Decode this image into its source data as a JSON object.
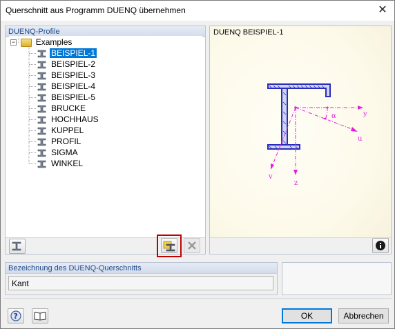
{
  "window": {
    "title": "Querschnitt aus Programm DUENQ übernehmen",
    "close_glyph": "✕"
  },
  "left_group": {
    "header": "DUENQ-Profile"
  },
  "tree": {
    "root": "Examples",
    "items": [
      {
        "label": "BEISPIEL-1",
        "selected": true
      },
      {
        "label": "BEISPIEL-2"
      },
      {
        "label": "BEISPIEL-3"
      },
      {
        "label": "BEISPIEL-4"
      },
      {
        "label": "BEISPIEL-5"
      },
      {
        "label": "BRUCKE"
      },
      {
        "label": "HOCHHAUS"
      },
      {
        "label": "KUPPEL"
      },
      {
        "label": "PROFIL"
      },
      {
        "label": "SIGMA"
      },
      {
        "label": "WINKEL"
      }
    ]
  },
  "preview": {
    "title": "DUENQ BEISPIEL-1",
    "axis_labels": {
      "y": "y",
      "u": "u",
      "v": "v",
      "z": "z",
      "alpha": "α"
    },
    "colors": {
      "section": "#2b2bbd",
      "axes": "#e020e0"
    }
  },
  "description_group": {
    "header": "Bezeichnung des DUENQ-Querschnitts",
    "value": "Kant"
  },
  "buttons": {
    "ok": "OK",
    "cancel": "Abbrechen"
  },
  "icons": {
    "profile": "profile-icon",
    "import": "import-icon",
    "delete": "delete-icon",
    "info": "info-icon",
    "help": "help-icon",
    "book": "book-icon"
  }
}
